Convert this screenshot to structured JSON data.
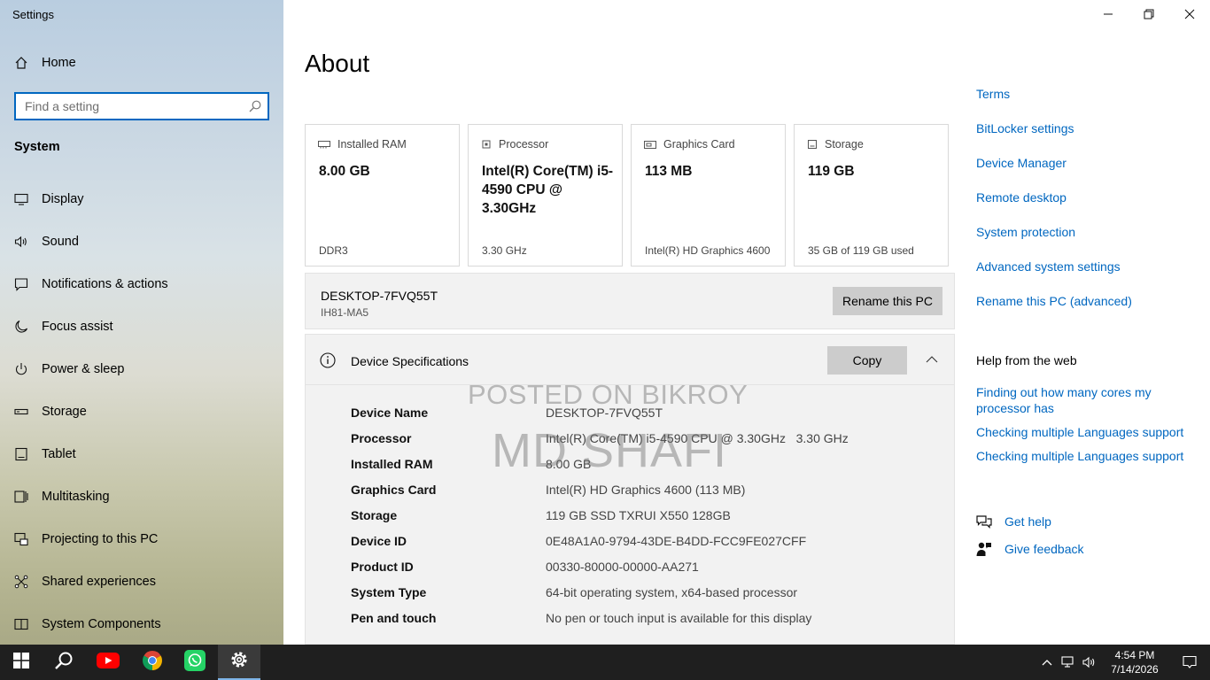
{
  "window": {
    "title": "Settings"
  },
  "sidebar": {
    "home_label": "Home",
    "search_placeholder": "Find a setting",
    "section_title": "System",
    "items": [
      {
        "label": "Display",
        "icon": "monitor-icon"
      },
      {
        "label": "Sound",
        "icon": "speaker-icon"
      },
      {
        "label": "Notifications & actions",
        "icon": "notification-icon"
      },
      {
        "label": "Focus assist",
        "icon": "moon-icon"
      },
      {
        "label": "Power & sleep",
        "icon": "power-icon"
      },
      {
        "label": "Storage",
        "icon": "storage-icon"
      },
      {
        "label": "Tablet",
        "icon": "tablet-icon"
      },
      {
        "label": "Multitasking",
        "icon": "multitasking-icon"
      },
      {
        "label": "Projecting to this PC",
        "icon": "project-icon"
      },
      {
        "label": "Shared experiences",
        "icon": "share-icon"
      },
      {
        "label": "System Components",
        "icon": "components-icon"
      }
    ]
  },
  "main": {
    "title": "About",
    "cards": [
      {
        "label": "Installed RAM",
        "value": "8.00 GB",
        "sub": "DDR3",
        "icon": "ram-icon"
      },
      {
        "label": "Processor",
        "value": "Intel(R) Core(TM) i5-4590 CPU @ 3.30GHz",
        "sub": "3.30 GHz",
        "icon": "processor-icon"
      },
      {
        "label": "Graphics Card",
        "value": "113 MB",
        "sub": "Intel(R) HD Graphics 4600",
        "icon": "graphics-icon"
      },
      {
        "label": "Storage",
        "value": "119 GB",
        "sub": "35 GB of 119 GB used",
        "icon": "storage-icon"
      }
    ],
    "pc": {
      "name": "DESKTOP-7FVQ55T",
      "model": "IH81-MA5",
      "rename_label": "Rename this PC"
    },
    "specs": {
      "title": "Device Specifications",
      "copy_label": "Copy",
      "rows": [
        {
          "key": "Device Name",
          "value": "DESKTOP-7FVQ55T"
        },
        {
          "key": "Processor",
          "value": "Intel(R) Core(TM) i5-4590 CPU @ 3.30GHz   3.30 GHz"
        },
        {
          "key": "Installed RAM",
          "value": "8.00 GB"
        },
        {
          "key": "Graphics Card",
          "value": "Intel(R) HD Graphics 4600 (113 MB)"
        },
        {
          "key": "Storage",
          "value": "119 GB SSD TXRUI X550 128GB"
        },
        {
          "key": "Device ID",
          "value": "0E48A1A0-9794-43DE-B4DD-FCC9FE027CFF"
        },
        {
          "key": "Product ID",
          "value": "00330-80000-00000-AA271"
        },
        {
          "key": "System Type",
          "value": "64-bit operating system, x64-based processor"
        },
        {
          "key": "Pen and touch",
          "value": "No pen or touch input is available for this display"
        }
      ]
    },
    "watermark": {
      "line1": "POSTED ON BIKROY",
      "line2": "MD SHAFI"
    }
  },
  "right": {
    "links": [
      "Terms",
      "BitLocker settings",
      "Device Manager",
      "Remote desktop",
      "System protection",
      "Advanced system settings",
      "Rename this PC (advanced)"
    ],
    "help_title": "Help from the web",
    "help_links": [
      "Finding out how many cores my processor has",
      "Checking multiple Languages support",
      "Checking multiple Languages support"
    ],
    "get_help": "Get help",
    "give_feedback": "Give feedback"
  },
  "taskbar": {
    "apps": [
      "start-icon",
      "search-icon",
      "youtube-icon",
      "chrome-icon",
      "whatsapp-icon",
      "settings-icon"
    ],
    "time": "4:54 PM",
    "date": "7/14/2026",
    "colors": {
      "accent": "#0067c0",
      "taskbar": "#1f1f1f",
      "youtube": "#ff0000",
      "whatsapp": "#25d366"
    }
  }
}
